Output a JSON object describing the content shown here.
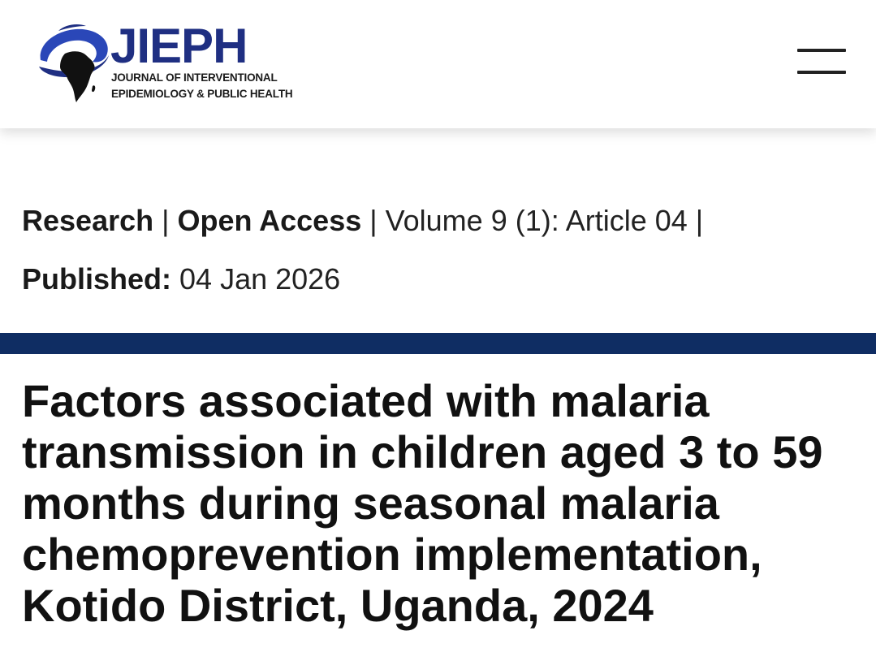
{
  "header": {
    "logo": {
      "name": "JIEPH",
      "subtitle_line1": "JOURNAL OF INTERVENTIONAL",
      "subtitle_line2": "EPIDEMIOLOGY & PUBLIC HEALTH",
      "brand_color": "#1f2f82",
      "accent_color": "#2a47b8"
    },
    "menu_icon": "hamburger-menu-icon"
  },
  "article": {
    "type": "Research",
    "access": "Open Access",
    "volume_article": "Volume 9 (1): Article  04",
    "published_label": "Published:",
    "published_date": "04 Jan 2026",
    "title": "Factors associated with malaria transmission in children aged 3 to 59 months during seasonal malaria chemoprevention implementation, Kotido District, Uganda, 2024"
  },
  "colors": {
    "divider": "#0f2d63",
    "text": "#1a1a1a",
    "background": "#ffffff"
  }
}
